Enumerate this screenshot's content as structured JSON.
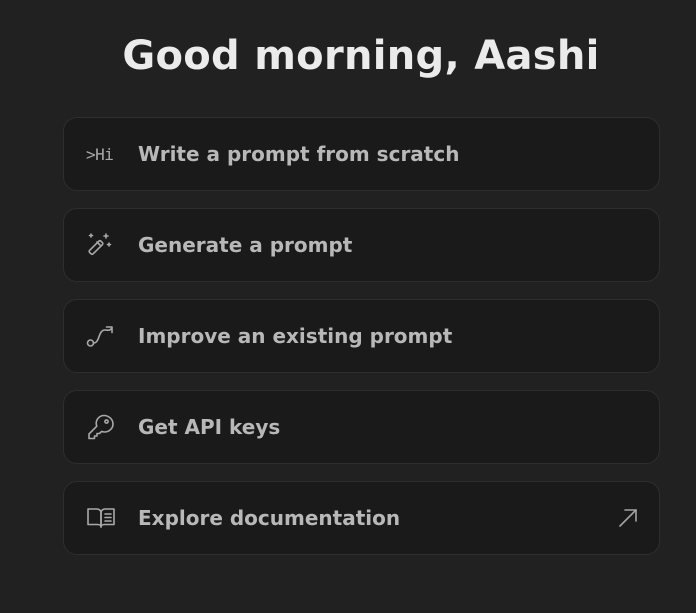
{
  "header": {
    "greeting": "Good morning, Aashi"
  },
  "actions": [
    {
      "label": "Write a prompt from scratch",
      "icon": "prompt-terminal-icon",
      "icon_text": ">Hi"
    },
    {
      "label": "Generate a prompt",
      "icon": "magic-wand-icon"
    },
    {
      "label": "Improve an existing prompt",
      "icon": "curved-arrow-icon"
    },
    {
      "label": "Get API keys",
      "icon": "key-icon"
    },
    {
      "label": "Explore documentation",
      "icon": "open-book-icon",
      "external_icon": "external-link-arrow-icon"
    }
  ]
}
